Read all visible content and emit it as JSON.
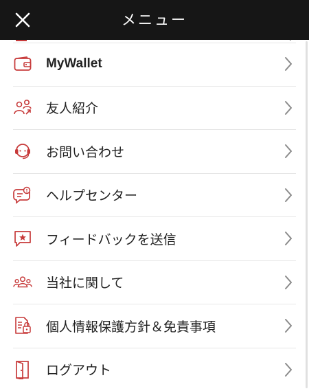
{
  "header": {
    "title": "メニュー",
    "close_icon": "close-icon"
  },
  "accent_color": "#c73a3a",
  "header_color": "#161616",
  "menu": {
    "items": [
      {
        "label": "MyWallet",
        "icon": "wallet-icon"
      },
      {
        "label": "友人紹介",
        "icon": "refer-friend-icon"
      },
      {
        "label": "お問い合わせ",
        "icon": "headset-icon"
      },
      {
        "label": "ヘルプセンター",
        "icon": "help-chat-icon"
      },
      {
        "label": "フィードバックを送信",
        "icon": "feedback-icon"
      },
      {
        "label": "当社に関して",
        "icon": "people-group-icon"
      },
      {
        "label": "個人情報保護方針＆免責事項",
        "icon": "privacy-document-icon"
      },
      {
        "label": "ログアウト",
        "icon": "logout-door-icon"
      }
    ]
  }
}
